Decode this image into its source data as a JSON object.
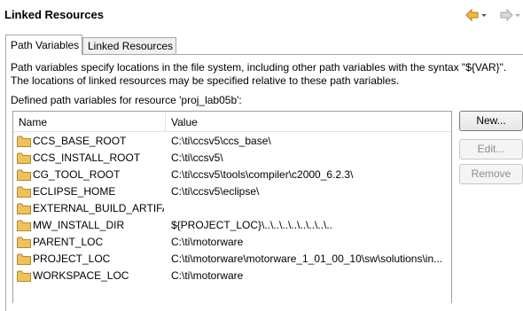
{
  "header": {
    "title": "Linked Resources",
    "back_icon": "arrow-left-icon",
    "forward_icon": "arrow-right-icon",
    "colors": {
      "back_arrow": "#e8a23a",
      "forward_arrow": "#b8b8b8"
    }
  },
  "tabs": [
    {
      "label": "Path Variables",
      "active": true
    },
    {
      "label": "Linked Resources",
      "active": false
    }
  ],
  "description": {
    "line1": "Path variables specify locations in the file system, including other path variables with the syntax \"${VAR}\".",
    "line2": "The locations of linked resources may be specified relative to these path variables."
  },
  "defined_label": "Defined path variables for resource 'proj_lab05b':",
  "table": {
    "columns": [
      "Name",
      "Value"
    ],
    "rows": [
      {
        "name": "CCS_BASE_ROOT",
        "value": "C:\\ti\\ccsv5\\ccs_base\\"
      },
      {
        "name": "CCS_INSTALL_ROOT",
        "value": "C:\\ti\\ccsv5\\"
      },
      {
        "name": "CG_TOOL_ROOT",
        "value": "C:\\ti\\ccsv5\\tools\\compiler\\c2000_6.2.3\\"
      },
      {
        "name": "ECLIPSE_HOME",
        "value": "C:\\ti\\ccsv5\\eclipse\\"
      },
      {
        "name": "EXTERNAL_BUILD_ARTIFA...",
        "value": ""
      },
      {
        "name": "MW_INSTALL_DIR",
        "value": "${PROJECT_LOC}\\..\\..\\..\\..\\..\\..\\..\\.."
      },
      {
        "name": "PARENT_LOC",
        "value": "C:\\ti\\motorware"
      },
      {
        "name": "PROJECT_LOC",
        "value": "C:\\ti\\motorware\\motorware_1_01_00_10\\sw\\solutions\\in..."
      },
      {
        "name": "WORKSPACE_LOC",
        "value": "C:\\ti\\motorware"
      }
    ],
    "row_icon": "folder-icon",
    "folder_color": "#e8b84a"
  },
  "buttons": {
    "new": "New...",
    "edit": "Edit...",
    "remove": "Remove"
  }
}
